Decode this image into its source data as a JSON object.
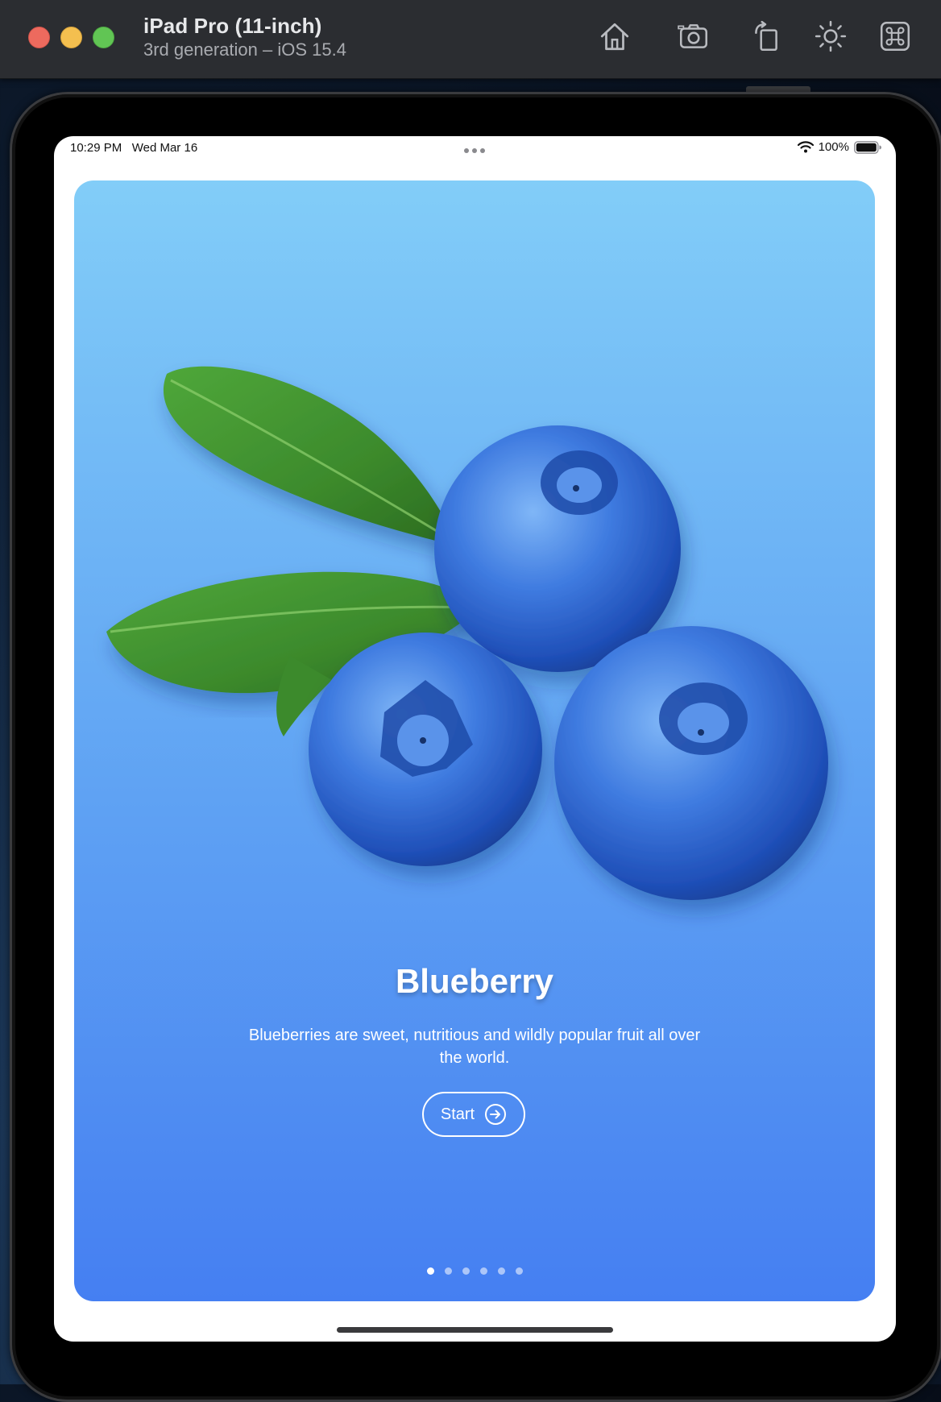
{
  "simulator": {
    "device_name": "iPad Pro (11-inch)",
    "device_subtitle": "3rd generation – iOS 15.4",
    "toolbar": [
      "home-icon",
      "screenshot-icon",
      "rotate-icon",
      "appearance-icon",
      "shortcuts-icon"
    ]
  },
  "status_bar": {
    "time": "10:29 PM",
    "date": "Wed Mar 16",
    "battery": "100%"
  },
  "onboarding": {
    "title": "Blueberry",
    "description": "Blueberries are sweet, nutritious and wildly popular fruit all over the world.",
    "start_label": "Start",
    "page_count": 6,
    "current_page": 1,
    "colors": {
      "gradient_top": "#82cdf8",
      "gradient_bottom": "#457ff2",
      "berry": "#3f7be0",
      "leaf": "#3c8a2c"
    }
  }
}
